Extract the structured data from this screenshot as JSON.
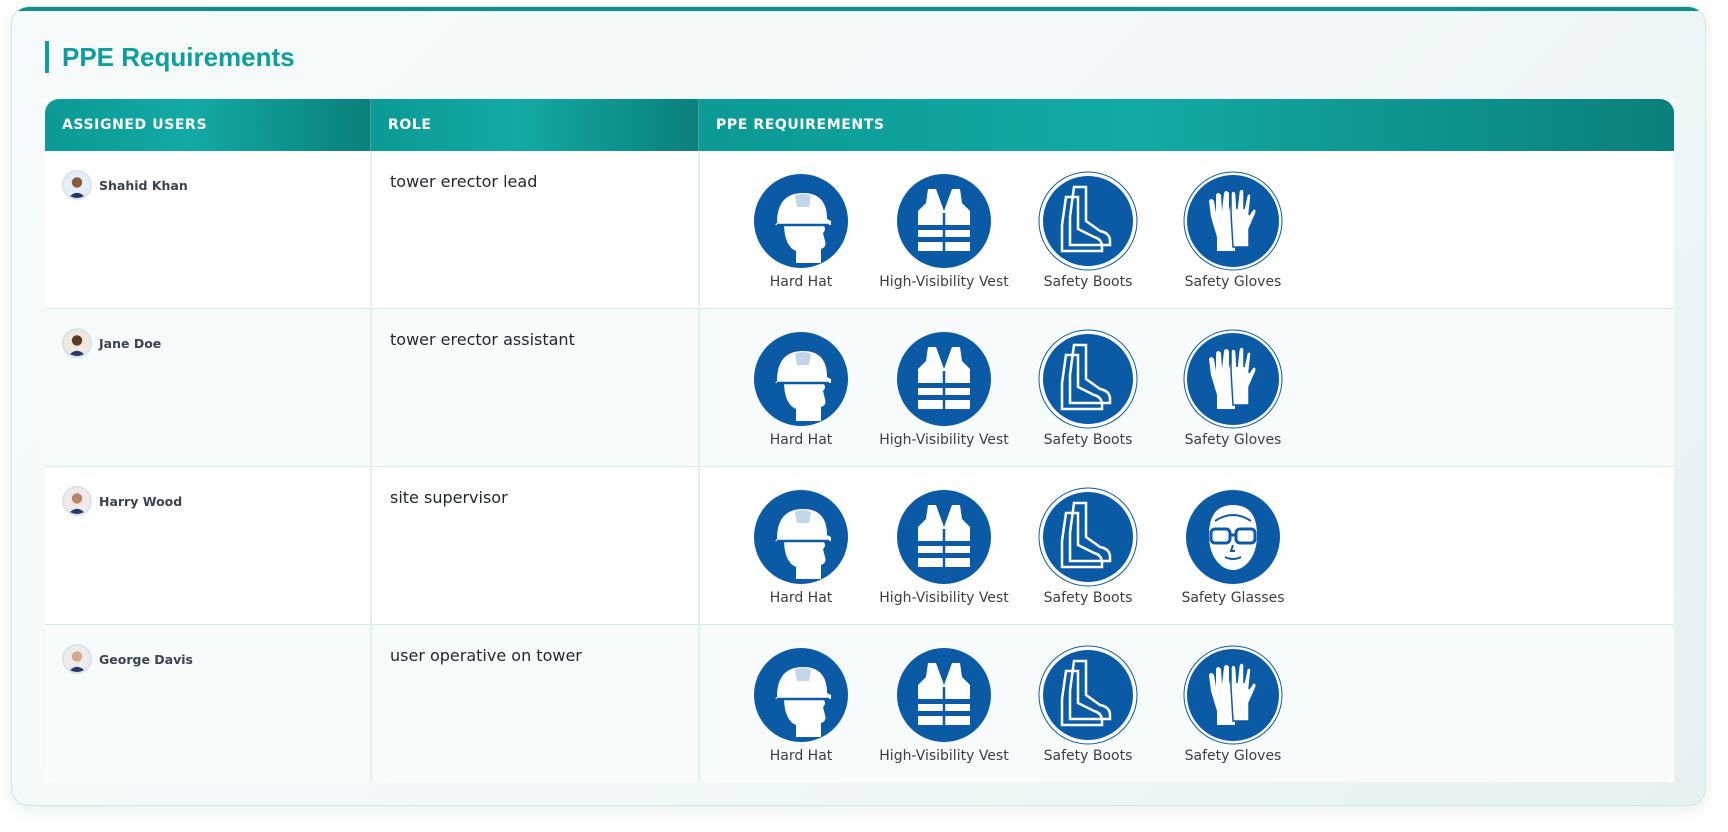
{
  "title": "PPE Requirements",
  "table": {
    "headers": [
      "ASSIGNED USERS",
      "ROLE",
      "PPE REQUIREMENTS"
    ],
    "rows": [
      {
        "user": "Shahid Khan",
        "role": "tower erector lead",
        "ppe": [
          {
            "label": "Hard Hat",
            "icon": "hard-hat"
          },
          {
            "label": "High-Visibility Vest",
            "icon": "high-visibility-vest"
          },
          {
            "label": "Safety Boots",
            "icon": "safety-boots"
          },
          {
            "label": "Safety Gloves",
            "icon": "safety-gloves"
          }
        ]
      },
      {
        "user": "Jane Doe",
        "role": "tower erector assistant",
        "ppe": [
          {
            "label": "Hard Hat",
            "icon": "hard-hat"
          },
          {
            "label": "High-Visibility Vest",
            "icon": "high-visibility-vest"
          },
          {
            "label": "Safety Boots",
            "icon": "safety-boots"
          },
          {
            "label": "Safety Gloves",
            "icon": "safety-gloves"
          }
        ]
      },
      {
        "user": "Harry Wood",
        "role": "site supervisor",
        "ppe": [
          {
            "label": "Hard Hat",
            "icon": "hard-hat"
          },
          {
            "label": "High-Visibility Vest",
            "icon": "high-visibility-vest"
          },
          {
            "label": "Safety Boots",
            "icon": "safety-boots"
          },
          {
            "label": "Safety Glasses",
            "icon": "safety-glasses"
          }
        ]
      },
      {
        "user": "George Davis",
        "role": "user operative on tower",
        "ppe": [
          {
            "label": "Hard Hat",
            "icon": "hard-hat"
          },
          {
            "label": "High-Visibility Vest",
            "icon": "high-visibility-vest"
          },
          {
            "label": "Safety Boots",
            "icon": "safety-boots"
          },
          {
            "label": "Safety Gloves",
            "icon": "safety-gloves"
          }
        ]
      }
    ]
  },
  "colors": {
    "accent": "#0f9e9a",
    "header_start": "#0b9a95",
    "header_end": "#0b807c",
    "ppe_blue": "#0b5aa6"
  }
}
